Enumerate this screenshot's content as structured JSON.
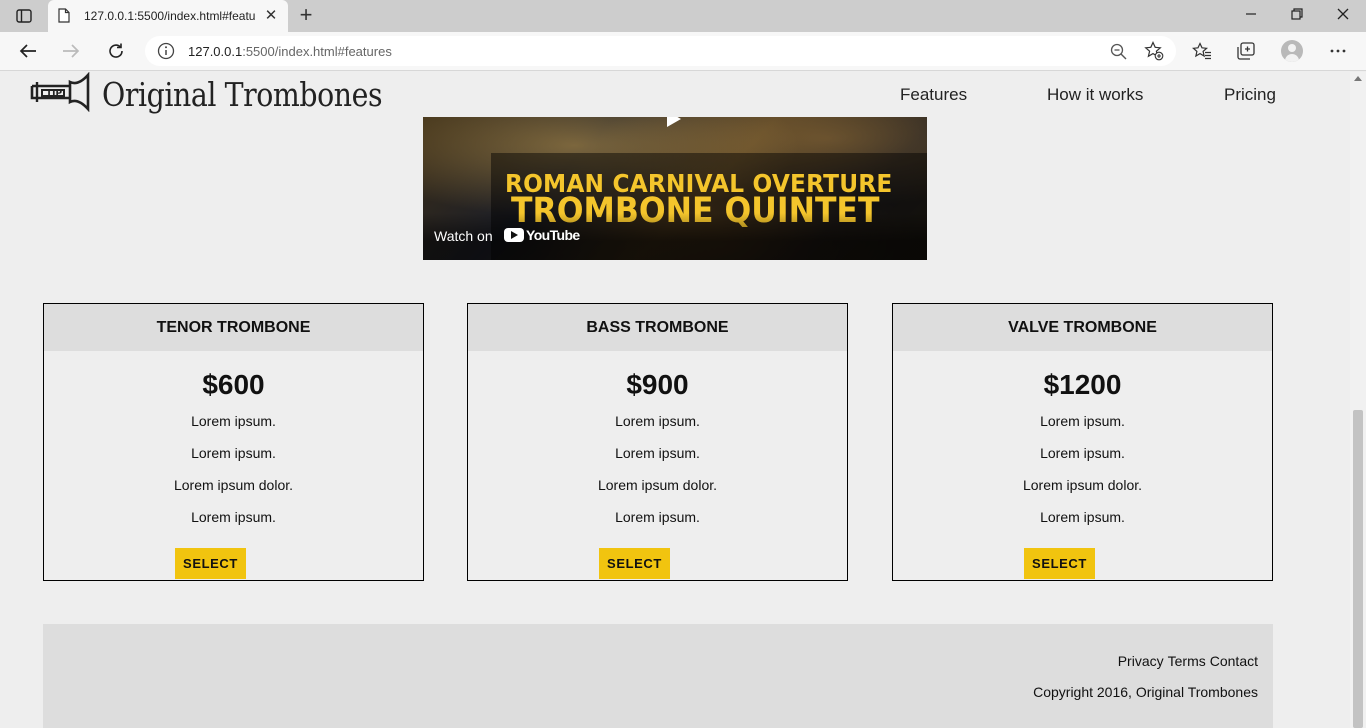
{
  "browser": {
    "tab_title": "127.0.0.1:5500/index.html#featu",
    "url_host": "127.0.0.1",
    "url_rest": ":5500/index.html#features"
  },
  "header": {
    "logo_text": "Original Trombones",
    "nav": [
      "Features",
      "How it works",
      "Pricing"
    ]
  },
  "video": {
    "title_line1": "ROMAN CARNIVAL OVERTURE",
    "title_line2": "TROMBONE QUINTET",
    "watch_on": "Watch on",
    "youtube": "YouTube"
  },
  "pricing": [
    {
      "name": "TENOR TROMBONE",
      "price": "$600",
      "features": [
        "Lorem ipsum.",
        "Lorem ipsum.",
        "Lorem ipsum dolor.",
        "Lorem ipsum."
      ],
      "button": "SELECT"
    },
    {
      "name": "BASS TROMBONE",
      "price": "$900",
      "features": [
        "Lorem ipsum.",
        "Lorem ipsum.",
        "Lorem ipsum dolor.",
        "Lorem ipsum."
      ],
      "button": "SELECT"
    },
    {
      "name": "VALVE TROMBONE",
      "price": "$1200",
      "features": [
        "Lorem ipsum.",
        "Lorem ipsum.",
        "Lorem ipsum dolor.",
        "Lorem ipsum."
      ],
      "button": "SELECT"
    }
  ],
  "footer": {
    "links": [
      "Privacy",
      "Terms",
      "Contact"
    ],
    "copyright": "Copyright 2016, Original Trombones"
  },
  "colors": {
    "accent": "#f1c40f",
    "video_text": "#f4c52c",
    "page_bg": "#eeeeee",
    "panel_bg": "#dddddd"
  }
}
